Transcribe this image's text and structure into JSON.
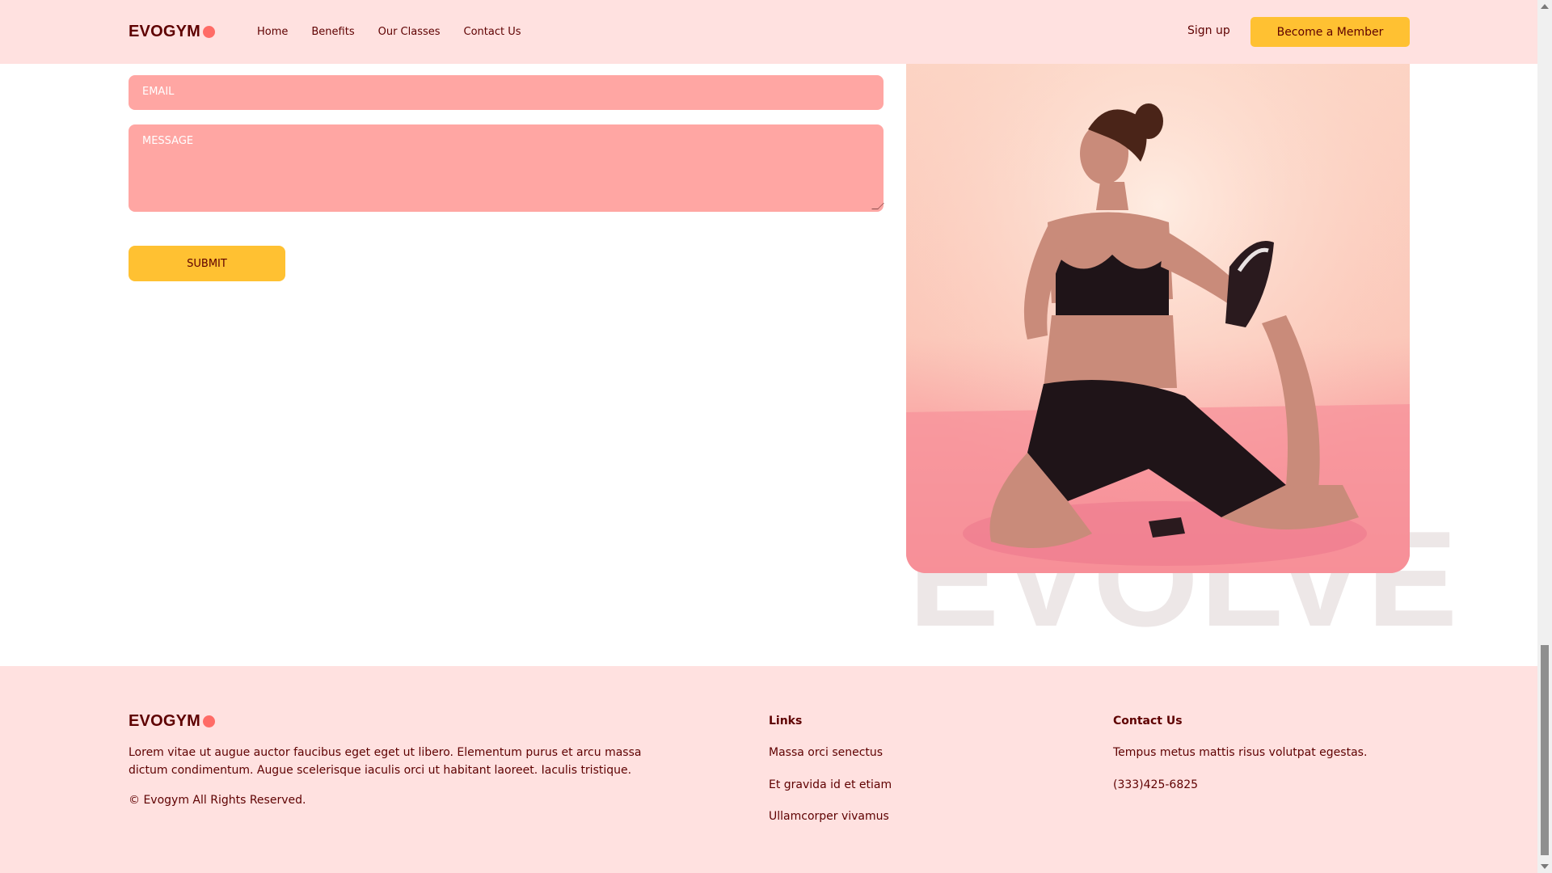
{
  "navbar": {
    "logo_text": "EVOGYM",
    "links": [
      "Home",
      "Benefits",
      "Our Classes",
      "Contact Us"
    ],
    "signup_label": "Sign up",
    "member_label": "Become a Member"
  },
  "form": {
    "email_placeholder": "EMAIL",
    "message_placeholder": "MESSAGE",
    "submit_label": "SUBMIT"
  },
  "hero": {
    "watermark_text": "EVOLVE"
  },
  "footer": {
    "logo_text": "EVOGYM",
    "description": "Lorem vitae ut augue auctor faucibus eget eget ut libero. Elementum purus et arcu massa dictum condimentum. Augue scelerisque iaculis orci ut habitant laoreet. Iaculis tristique.",
    "copyright": "© Evogym All Rights Reserved.",
    "links_heading": "Links",
    "links": [
      "Massa orci senectus",
      "Et gravida id et etiam",
      "Ullamcorper vivamus"
    ],
    "contact_heading": "Contact Us",
    "contact_text": "Tempus metus mattis risus volutpat egestas.",
    "contact_phone": "(333)425-6825"
  },
  "colors": {
    "primary_bg": "#ffe1e0",
    "accent": "#ffc132",
    "input_bg": "#ffa6a3",
    "text": "#5e0000",
    "logo_dot": "#ff6b66"
  }
}
